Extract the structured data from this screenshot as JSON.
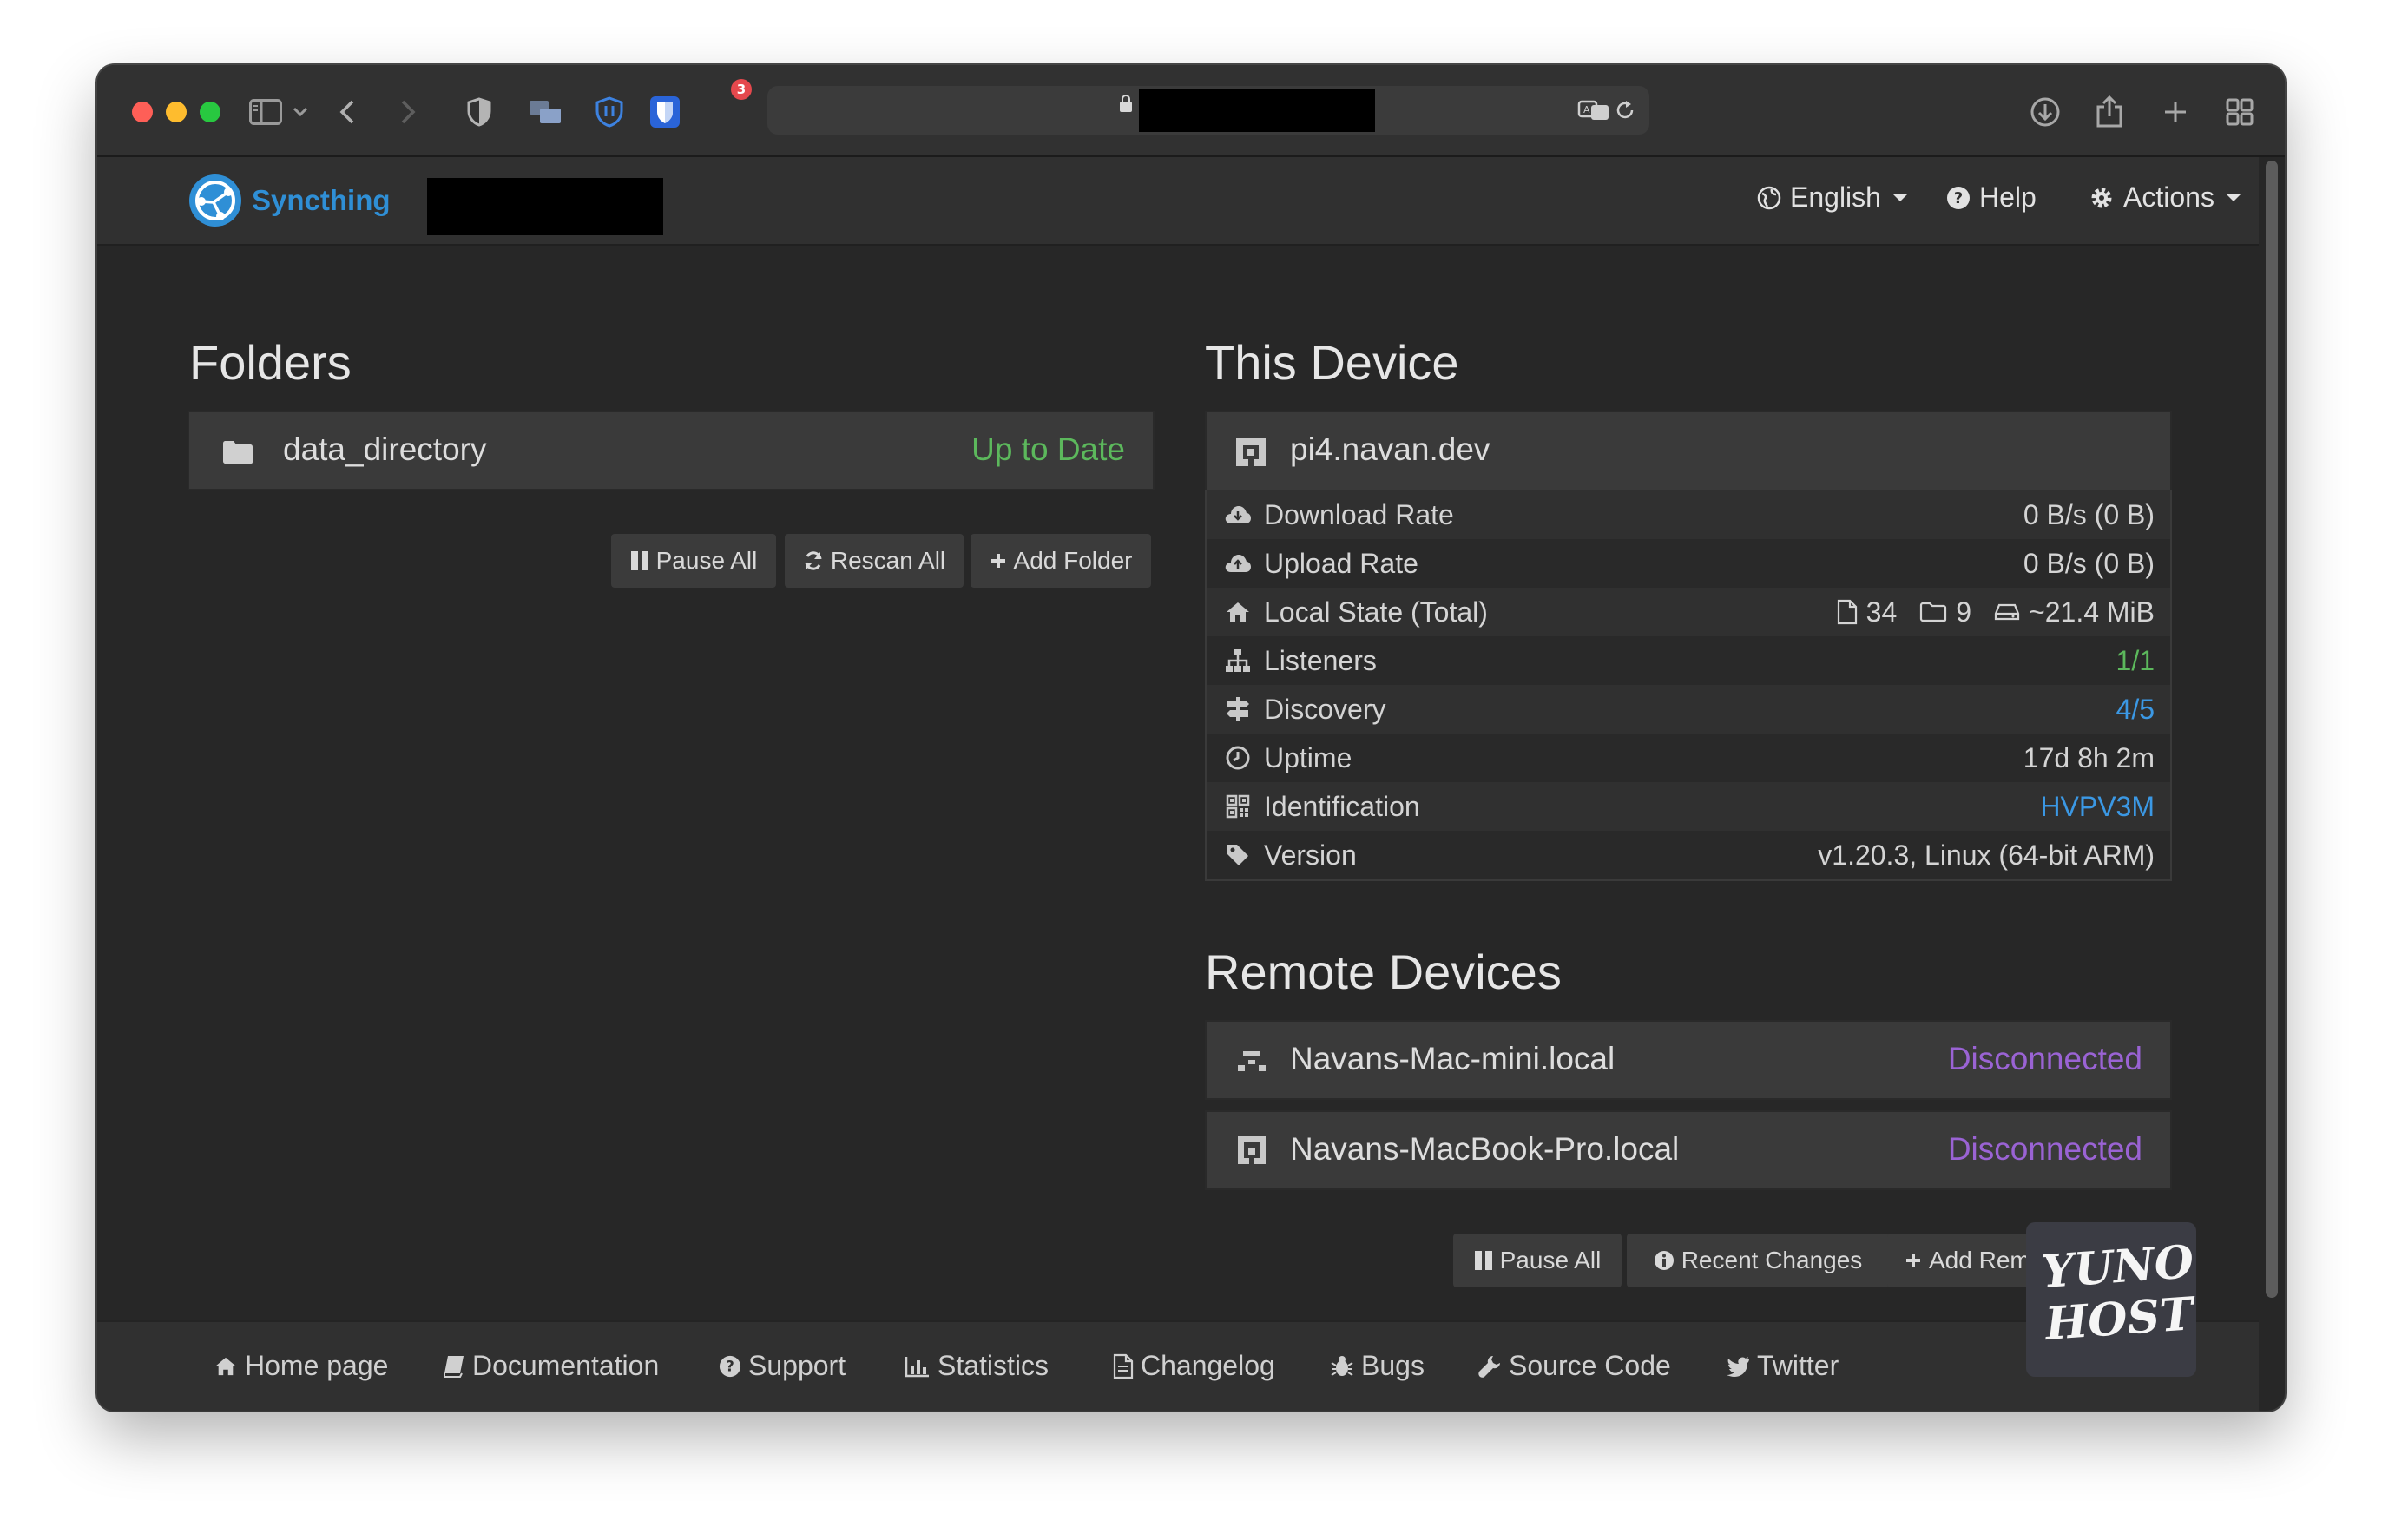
{
  "browser": {
    "tab_badge_count": "3"
  },
  "navbar": {
    "brand": "Syncthing",
    "language": "English",
    "help": "Help",
    "actions": "Actions"
  },
  "folders": {
    "heading": "Folders",
    "items": [
      {
        "name": "data_directory",
        "status": "Up to Date"
      }
    ],
    "buttons": {
      "pause_all": "Pause All",
      "rescan_all": "Rescan All",
      "add_folder": "Add Folder"
    }
  },
  "this_device": {
    "heading": "This Device",
    "name": "pi4.navan.dev",
    "rows": [
      {
        "label": "Download Rate",
        "value": "0 B/s (0 B)",
        "icon": "cloud-download-icon"
      },
      {
        "label": "Upload Rate",
        "value": "0 B/s (0 B)",
        "icon": "cloud-upload-icon"
      },
      {
        "label": "Local State (Total)",
        "value": "",
        "icon": "home-icon"
      },
      {
        "label": "Listeners",
        "value": "1/1",
        "icon": "sitemap-icon"
      },
      {
        "label": "Discovery",
        "value": "4/5",
        "icon": "signpost-icon"
      },
      {
        "label": "Uptime",
        "value": "17d 8h 2m",
        "icon": "clock-icon"
      },
      {
        "label": "Identification",
        "value": "HVPV3M",
        "icon": "qrcode-icon"
      },
      {
        "label": "Version",
        "value": "v1.20.3, Linux (64-bit ARM)",
        "icon": "tag-icon"
      }
    ],
    "local_state": {
      "files": "34",
      "folders": "9",
      "size": "~21.4 MiB"
    }
  },
  "remote_devices": {
    "heading": "Remote Devices",
    "items": [
      {
        "name": "Navans-Mac-mini.local",
        "status": "Disconnected"
      },
      {
        "name": "Navans-MacBook-Pro.local",
        "status": "Disconnected"
      }
    ],
    "buttons": {
      "pause_all": "Pause All",
      "recent_changes": "Recent Changes",
      "add_remote": "Add Remote Device"
    }
  },
  "footer": {
    "links": [
      "Home page",
      "Documentation",
      "Support",
      "Statistics",
      "Changelog",
      "Bugs",
      "Source Code",
      "Twitter"
    ]
  },
  "watermark": {
    "line1": "YUNO",
    "line2": "HOST"
  },
  "colors": {
    "up_to_date": "#5cb85c",
    "listeners": "#5cb85c",
    "discovery": "#3b98e4",
    "identification": "#3b98e4",
    "disconnected": "#9a63d4",
    "brand": "#2f8fd6"
  }
}
